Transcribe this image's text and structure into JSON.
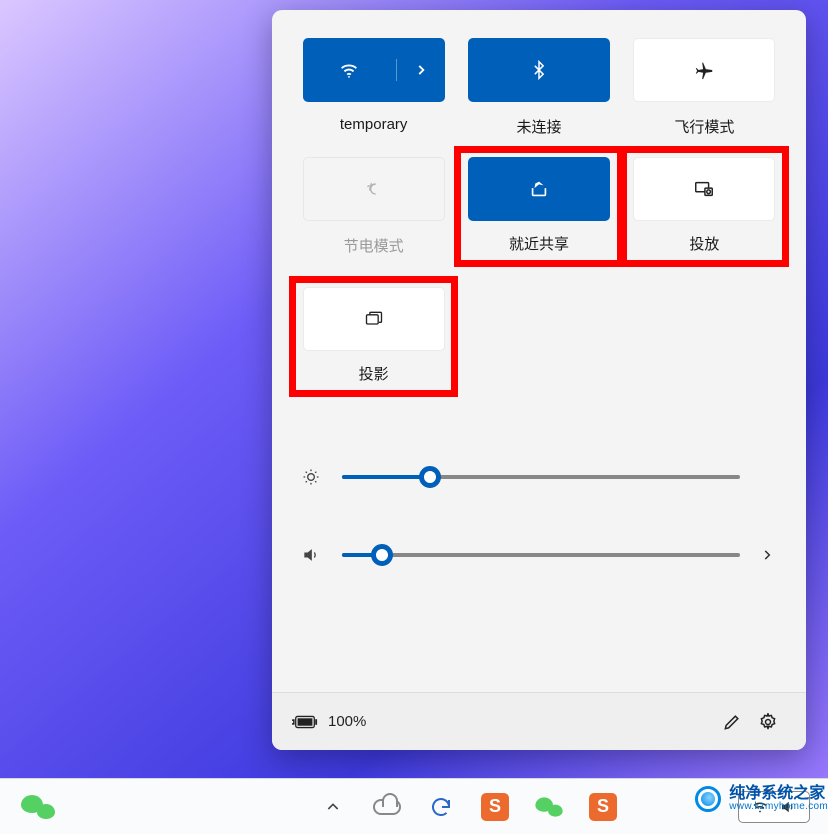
{
  "panel": {
    "tiles": [
      {
        "id": "wifi",
        "label": "temporary",
        "state": "active",
        "highlight": false,
        "icon": "wifi"
      },
      {
        "id": "bluetooth",
        "label": "未连接",
        "state": "active",
        "highlight": false,
        "icon": "bluetooth"
      },
      {
        "id": "airplane",
        "label": "飞行模式",
        "state": "inactive",
        "highlight": false,
        "icon": "airplane"
      },
      {
        "id": "battery",
        "label": "节电模式",
        "state": "disabled",
        "highlight": false,
        "icon": "battery-saver"
      },
      {
        "id": "share",
        "label": "就近共享",
        "state": "active",
        "highlight": true,
        "icon": "share"
      },
      {
        "id": "cast",
        "label": "投放",
        "state": "inactive",
        "highlight": true,
        "icon": "cast"
      },
      {
        "id": "project",
        "label": "投影",
        "state": "inactive",
        "highlight": true,
        "icon": "project"
      }
    ],
    "brightness_pct": 22,
    "volume_pct": 10,
    "battery_text": "100%"
  },
  "watermark": {
    "title": "纯净系统之家",
    "url": "www.kzmyhome.com"
  }
}
